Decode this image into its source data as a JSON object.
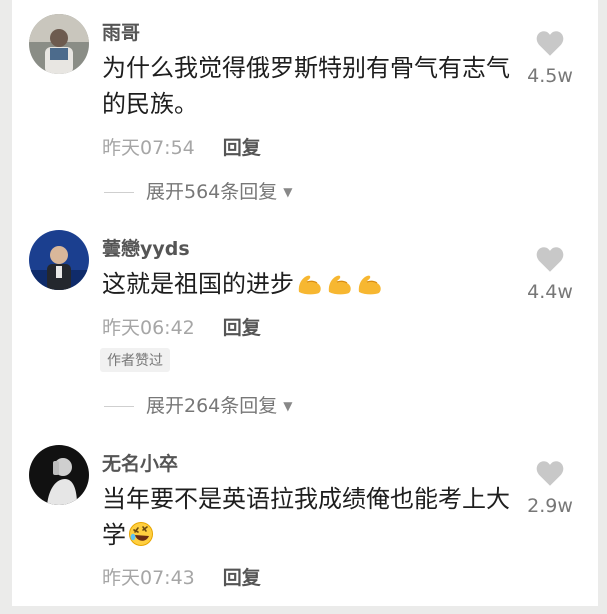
{
  "comments": [
    {
      "username": "雨哥",
      "text": "为什么我觉得俄罗斯特别有骨气有志气的民族。",
      "time": "昨天07:54",
      "reply_label": "回复",
      "likes": "4.5w",
      "expand": "展开564条回复"
    },
    {
      "username": "蕓戀yyds",
      "text": "这就是祖国的进步",
      "emojis": [
        "flexed-biceps",
        "flexed-biceps",
        "flexed-biceps"
      ],
      "time": "昨天06:42",
      "reply_label": "回复",
      "badge": "作者赞过",
      "likes": "4.4w",
      "expand": "展开264条回复"
    },
    {
      "username": "无名小卒",
      "text": "当年要不是英语拉我成绩俺也能考上大学",
      "emojis": [
        "rolling-on-floor-laughing"
      ],
      "time": "昨天07:43",
      "reply_label": "回复",
      "likes": "2.9w"
    }
  ]
}
